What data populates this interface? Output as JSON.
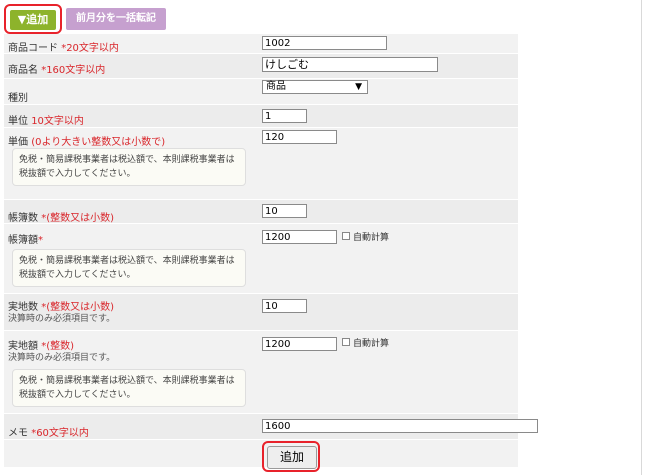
{
  "toolbar": {
    "add_label": "▼追加",
    "transfer_label": "前月分を一括転記"
  },
  "note_text": "免税・簡易課税事業者は税込額で、本則課税事業者は税抜額で入力してください。",
  "fields": {
    "code": {
      "label": "商品コード",
      "hint": "*20文字以内",
      "value": "1002"
    },
    "name": {
      "label": "商品名",
      "hint": "*160文字以内",
      "value": "けしごむ"
    },
    "type": {
      "label": "種別",
      "selected": "商品"
    },
    "unit": {
      "label": "単位",
      "hint": "10文字以内",
      "value": "1"
    },
    "price": {
      "label": "単価",
      "hint": "(0より大きい整数又は小数で)",
      "value": "120"
    },
    "book_qty": {
      "label": "帳簿数",
      "hint": "*(整数又は小数)",
      "value": "10"
    },
    "book_amount": {
      "label": "帳簿額",
      "hint": "*",
      "value": "1200",
      "auto_label": "自動計算"
    },
    "actual_qty": {
      "label": "実地数",
      "hint": "*(整数又は小数)",
      "sub": "決算時のみ必須項目です。",
      "value": "10"
    },
    "actual_amount": {
      "label": "実地額",
      "hint": "*(整数)",
      "sub": "決算時のみ必須項目です。",
      "value": "1200",
      "auto_label": "自動計算"
    },
    "memo": {
      "label": "メモ",
      "hint": "*60文字以内",
      "value": "1600"
    }
  },
  "submit_label": "追加"
}
